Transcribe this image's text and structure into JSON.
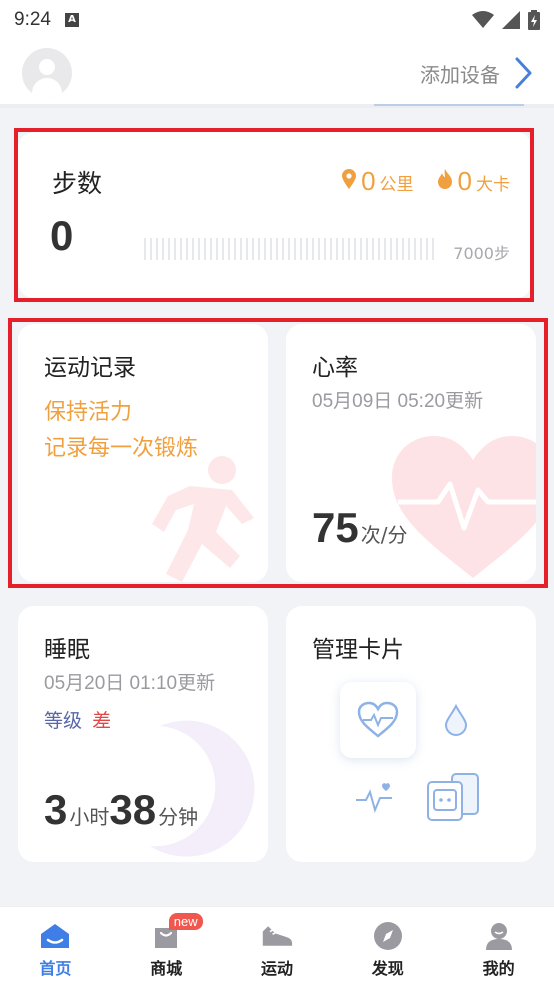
{
  "status_bar": {
    "time": "9:24"
  },
  "header": {
    "add_device_label": "添加设备"
  },
  "steps_card": {
    "title": "步数",
    "value": "0",
    "distance_value": "0",
    "distance_unit": "公里",
    "calories_value": "0",
    "calories_unit": "大卡",
    "goal_label": "7000步",
    "progress": 0
  },
  "exercise_card": {
    "title": "运动记录",
    "line1": "保持活力",
    "line2": "记录每一次锻炼"
  },
  "heart_card": {
    "title": "心率",
    "updated": "05月09日 05:20更新",
    "value": "75",
    "unit": "次/分"
  },
  "sleep_card": {
    "title": "睡眠",
    "updated": "05月20日 01:10更新",
    "level_label": "等级",
    "level_value": "差",
    "hours_value": "3",
    "hours_unit": "小时",
    "minutes_value": "38",
    "minutes_unit": "分钟"
  },
  "manage_card": {
    "title": "管理卡片"
  },
  "tabs": [
    {
      "label": "首页",
      "icon": "home-icon",
      "active": true
    },
    {
      "label": "商城",
      "icon": "shop-bag-icon",
      "badge": "new"
    },
    {
      "label": "运动",
      "icon": "shoe-icon"
    },
    {
      "label": "发现",
      "icon": "compass-icon"
    },
    {
      "label": "我的",
      "icon": "profile-icon"
    }
  ],
  "colors": {
    "accent_blue": "#3f7ee6",
    "orange": "#f0a03e",
    "highlight_red": "#e5202a",
    "level_poor": "#e04848"
  }
}
